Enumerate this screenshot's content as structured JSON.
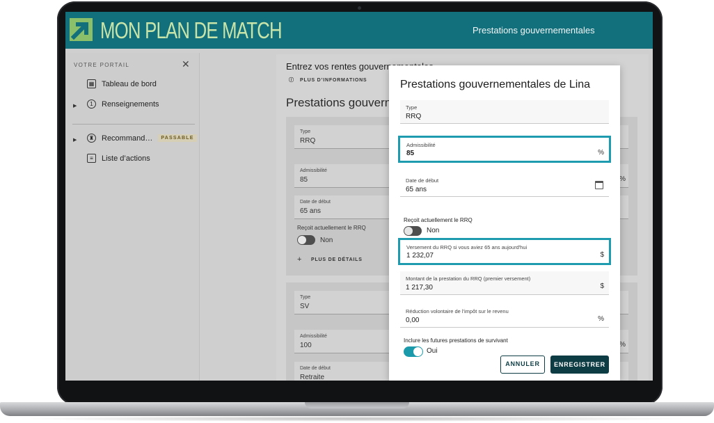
{
  "header": {
    "brand": "MON PLAN DE MATCH",
    "page_name": "Prestations gouvernementales"
  },
  "sidebar": {
    "title": "VOTRE PORTAIL",
    "items": [
      {
        "label": "Tableau de bord",
        "icon": "dashboard-icon"
      },
      {
        "label": "Renseignements",
        "icon": "number-one-icon"
      },
      {
        "label": "Recommand…",
        "icon": "recommendation-icon",
        "badge": "PASSABLE"
      },
      {
        "label": "Liste d’actions",
        "icon": "clipboard-icon"
      }
    ]
  },
  "main": {
    "heading": "Entrez vos rentes gouvernementales",
    "info_link": "PLUS D’INFORMATIONS",
    "section_title": "Prestations gouverne",
    "block1": {
      "type_label": "Type",
      "type_value": "RRQ",
      "adm_label": "Admissibilité",
      "adm_value": "85",
      "adm_unit": "%",
      "date_label": "Date de début",
      "date_value": "65 ans",
      "receives_label": "Reçoit actuellement le RRQ",
      "receives_value": "Non",
      "more_details": "PLUS DE DÉTAILS"
    },
    "block2": {
      "type_label": "Type",
      "type_value": "SV",
      "adm_label": "Admissibilité",
      "adm_value": "100",
      "adm_unit": "%",
      "date_label": "Date de début",
      "date_value": "Retraite"
    }
  },
  "modal": {
    "title": "Prestations gouvernementales de Lina",
    "type": {
      "label": "Type",
      "value": "RRQ"
    },
    "admissibility": {
      "label": "Admissibilité",
      "value": "85",
      "unit": "%"
    },
    "start_date": {
      "label": "Date de début",
      "value": "65 ans"
    },
    "receives": {
      "label": "Reçoit actuellement le RRQ",
      "value": "Non",
      "on": false
    },
    "payment_65": {
      "label": "Versement du RRQ si vous aviez 65 ans aujourd'hui",
      "value": "1 232,07",
      "unit": "$"
    },
    "benefit_amount": {
      "label": "Montant de la prestation du RRQ (premier versement)",
      "value": "1 217,30",
      "unit": "$"
    },
    "tax_reduction": {
      "label": "Réduction volontaire de l'impôt sur le revenu",
      "value": "0,00",
      "unit": "%"
    },
    "survivor": {
      "label": "Inclure les futures prestations de survivant",
      "value": "Oui",
      "on": true
    },
    "cancel_label": "ANNULER",
    "save_label": "ENREGISTRER"
  },
  "colors": {
    "brand_teal": "#11707c",
    "brand_green": "#c9e4a9",
    "accent": "#1f9bb0",
    "dark_button": "#0e3c44"
  }
}
